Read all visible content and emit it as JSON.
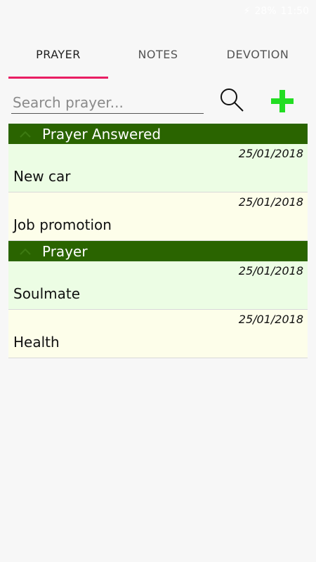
{
  "status_bar": {
    "bolt": "⚡",
    "text": "28%",
    "time": "11:50"
  },
  "tabs": [
    {
      "label": "PRAYER",
      "active": true
    },
    {
      "label": "NOTES",
      "active": false
    },
    {
      "label": "DEVOTION",
      "active": false
    }
  ],
  "search": {
    "placeholder": "Search prayer...",
    "value": ""
  },
  "icons": {
    "search": "search-icon",
    "add": "plus-icon",
    "chevron": "chevron-up-icon"
  },
  "colors": {
    "accent": "#e91e63",
    "group_header_bg": "#2a6400",
    "add_icon": "#22dd22",
    "row_green": "#ecfde4",
    "row_cream": "#fdfeea"
  },
  "groups": [
    {
      "title": "Prayer Answered",
      "items": [
        {
          "date": "25/01/2018",
          "title": "New car"
        },
        {
          "date": "25/01/2018",
          "title": "Job promotion"
        }
      ]
    },
    {
      "title": "Prayer",
      "items": [
        {
          "date": "25/01/2018",
          "title": "Soulmate"
        },
        {
          "date": "25/01/2018",
          "title": "Health"
        }
      ]
    }
  ]
}
